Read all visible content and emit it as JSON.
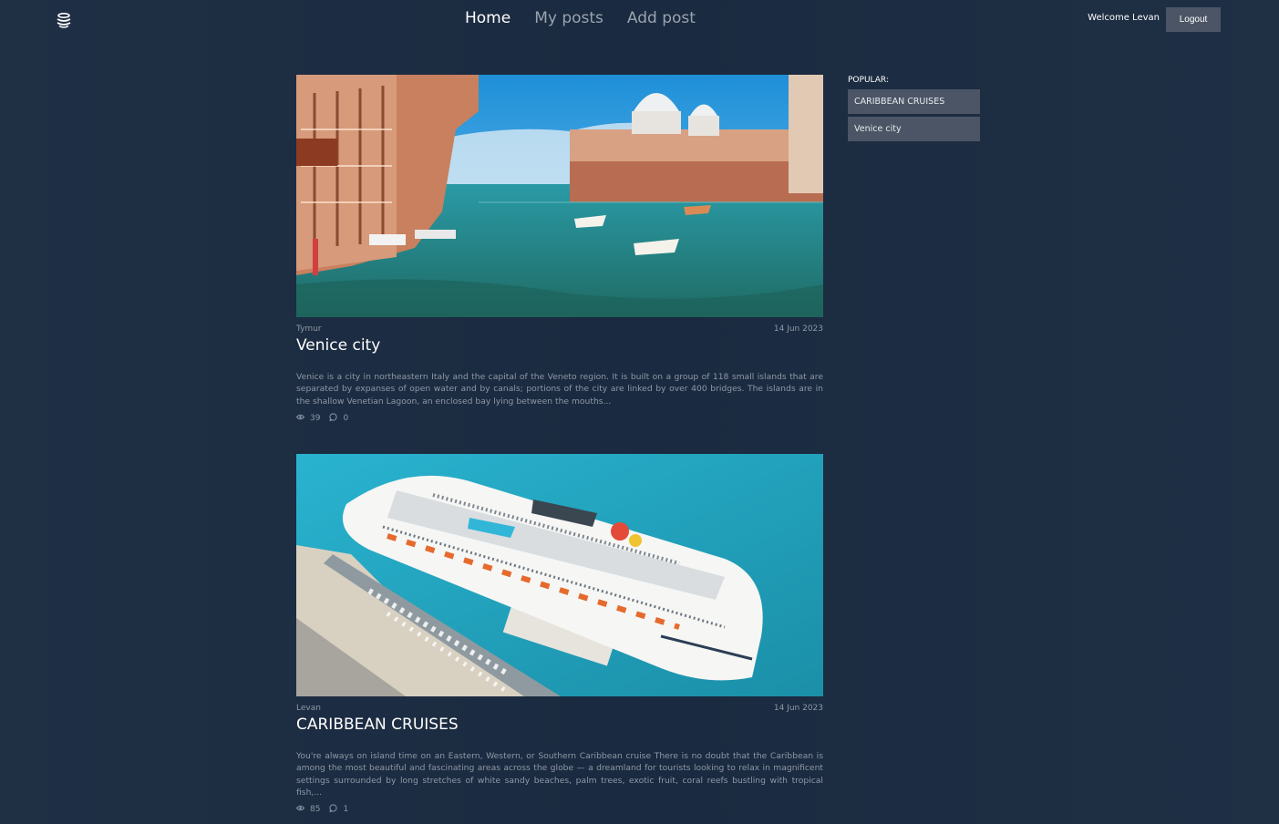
{
  "header": {
    "logo_icon": "globe-stack-icon",
    "nav": [
      {
        "label": "Home",
        "active": true
      },
      {
        "label": "My posts",
        "active": false
      },
      {
        "label": "Add post",
        "active": false
      }
    ],
    "welcome_text": "Welcome Levan",
    "logout_label": "Logout"
  },
  "posts": [
    {
      "image_subject": "Venice grand canal with boats",
      "author": "Tymur",
      "date": "14 Jun 2023",
      "title": "Venice city",
      "excerpt": "Venice is a city in northeastern Italy and the capital of the Veneto region. It is built on a group of 118 small islands that are separated by expanses of open water and by canals; portions of the city are linked by over 400 bridges. The islands are in the shallow Venetian Lagoon, an enclosed bay lying between the mouths...",
      "views": "39",
      "comments": "0"
    },
    {
      "image_subject": "Cruise ship docked at turquoise harbor",
      "author": "Levan",
      "date": "14 Jun 2023",
      "title": "CARIBBEAN CRUISES",
      "excerpt": "You're always on island time on an Eastern, Western, or Southern Caribbean cruise There is no doubt that the Caribbean is among the most beautiful and fascinating areas across the globe — a dreamland for tourists looking to relax in magnificent settings surrounded by long stretches of white sandy beaches, palm trees, exotic fruit, coral reefs bustling with tropical fish,...",
      "views": "85",
      "comments": "1"
    }
  ],
  "sidebar": {
    "label": "POPULAR:",
    "items": [
      {
        "label": "CARIBBEAN CRUISES"
      },
      {
        "label": "Venice city"
      }
    ]
  },
  "colors": {
    "background": "#1c2b40",
    "button": "#4b5565",
    "muted_text": "#8f98a6"
  }
}
